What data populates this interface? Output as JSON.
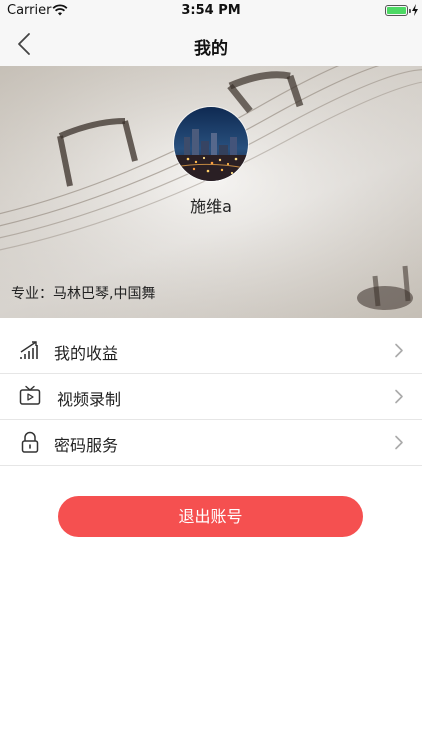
{
  "status_bar": {
    "carrier": "Carrier",
    "time": "3:54 PM",
    "battery_level": 1.0
  },
  "nav": {
    "title": "我的",
    "back_icon": "chevron-left-icon"
  },
  "profile": {
    "username": "施维a",
    "major_label": "专业：",
    "major_value": "马林巴琴,中国舞"
  },
  "menu": {
    "items": [
      {
        "label": "我的收益",
        "icon": "earnings-chart-icon"
      },
      {
        "label": "视频录制",
        "icon": "tv-video-icon"
      },
      {
        "label": "密码服务",
        "icon": "lock-icon"
      }
    ]
  },
  "logout": {
    "label": "退出账号"
  },
  "colors": {
    "accent": "#f55050",
    "battery": "#4cd964",
    "divider": "#e6e6e6",
    "nav_background": "#f7f7f7"
  }
}
